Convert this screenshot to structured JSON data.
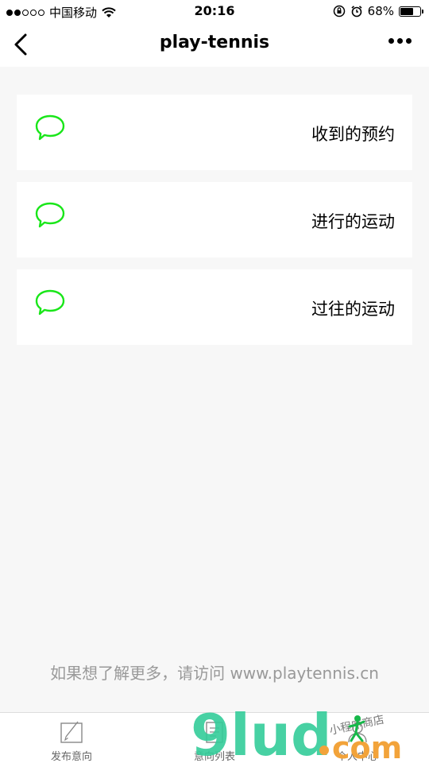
{
  "status_bar": {
    "carrier": "中国移动",
    "time": "20:16",
    "battery": "68%",
    "battery_level": 0.68
  },
  "nav": {
    "title": "play-tennis"
  },
  "cards": [
    {
      "label": "收到的预约",
      "icon": "chat-bubble-icon"
    },
    {
      "label": "进行的运动",
      "icon": "chat-bubble-icon"
    },
    {
      "label": "过往的运动",
      "icon": "chat-bubble-icon"
    }
  ],
  "footer": {
    "note": "如果想了解更多，请访问 www.playtennis.cn"
  },
  "tab_bar": {
    "tabs": [
      {
        "label": "发布意向",
        "icon": "pen-note-icon"
      },
      {
        "label": "意向列表",
        "icon": "list-icon"
      },
      {
        "label": "个人中心",
        "icon": "person-icon"
      }
    ]
  },
  "watermark": {
    "text": "9lud.com",
    "tagline": "小程序商店"
  },
  "colors": {
    "accent_green": "#19e619",
    "background": "#f7f7f7",
    "footer_text": "#999999"
  }
}
